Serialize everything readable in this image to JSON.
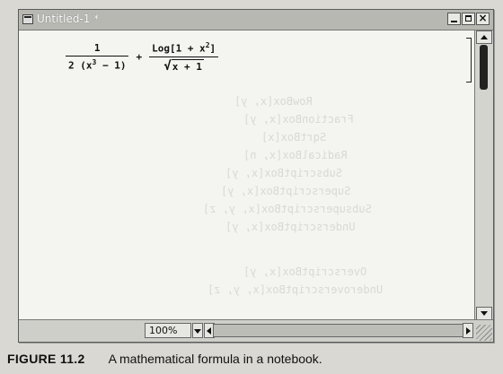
{
  "window": {
    "title": "Untitled-1 *"
  },
  "notebook": {
    "formula": {
      "term1_numerator": "1",
      "term1_denominator_pre": "2 (x",
      "term1_denominator_exp": "3",
      "term1_denominator_post": " − 1)",
      "operator": "+",
      "term2_numerator_pre": "Log[1 + x",
      "term2_numerator_exp": "2",
      "term2_numerator_post": "]",
      "term2_denominator_radicand": "x + 1"
    }
  },
  "statusbar": {
    "zoom": "100%"
  },
  "caption": {
    "label": "FIGURE 11.2",
    "text": "A mathematical formula in a notebook."
  },
  "colors": {
    "titlebar": "#b8b8b2",
    "content_bg": "#f4f4f0",
    "page_bg": "#d9d8d2"
  },
  "icons": {
    "window_icon": "notebook-window-icon",
    "minimize": "minimize-icon",
    "maximize": "maximize-icon",
    "close": "close-icon"
  }
}
